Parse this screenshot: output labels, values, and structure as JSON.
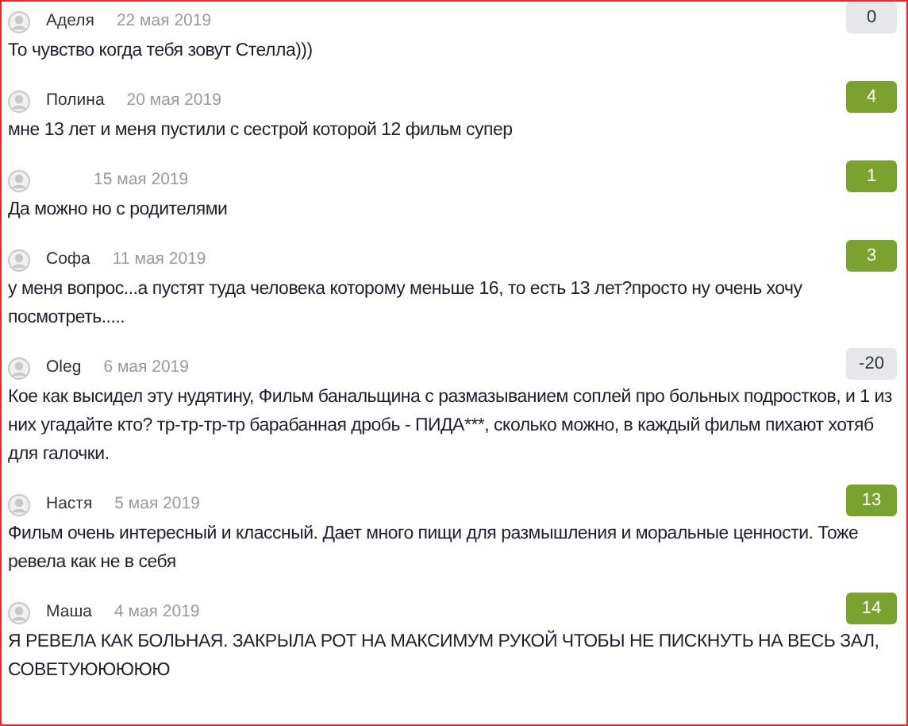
{
  "comments": [
    {
      "author": "Аделя",
      "date": "22 мая 2019",
      "score": "0",
      "color": "#e6e7ea",
      "text": "То чувство когда тебя зовут Стелла)))"
    },
    {
      "author": "Полина",
      "date": "20 мая 2019",
      "score": "4",
      "color": "#7aa22e",
      "text": "мне 13 лет и меня пустили с сестрой которой 12 фильм супер"
    },
    {
      "date": "15 мая 2019",
      "score": "1",
      "color": "#7aa22e",
      "text": "Да можно но с родителями"
    },
    {
      "author": "Софа",
      "date": "11 мая 2019",
      "score": "3",
      "color": "#7aa22e",
      "text": "у меня вопрос...а пустят туда человека которому меньше 16, то есть 13 лет?просто ну очень хочу посмотреть....."
    },
    {
      "author": "Oleg",
      "date": "6 мая 2019",
      "score": "-20",
      "color": "#e6e7ea",
      "text": "Кое как высидел эту нудятину, Фильм банальщина с размазыванием соплей про больных подростков, и 1 из них угадайте кто? тр-тр-тр-тр барабанная дробь - ПИДА***, сколько можно, в каждый фильм пихают хотяб для галочки."
    },
    {
      "author": "Настя",
      "date": "5 мая 2019",
      "score": "13",
      "color": "#7aa22e",
      "text": "Фильм очень интересный и классный. Дает много пищи для размышления и моральные ценности. Тоже ревела как не в себя"
    },
    {
      "author": "Маша",
      "date": "4 мая 2019",
      "score": "14",
      "color": "#7aa22e",
      "text": "Я РЕВЕЛА КАК БОЛЬНАЯ. ЗАКРЫЛА РОТ НА МАКСИМУМ РУКОЙ ЧТОБЫ НЕ ПИСКНУТЬ НА ВЕСЬ ЗАЛ, СОВЕТУЮЮЮЮЮ"
    }
  ]
}
